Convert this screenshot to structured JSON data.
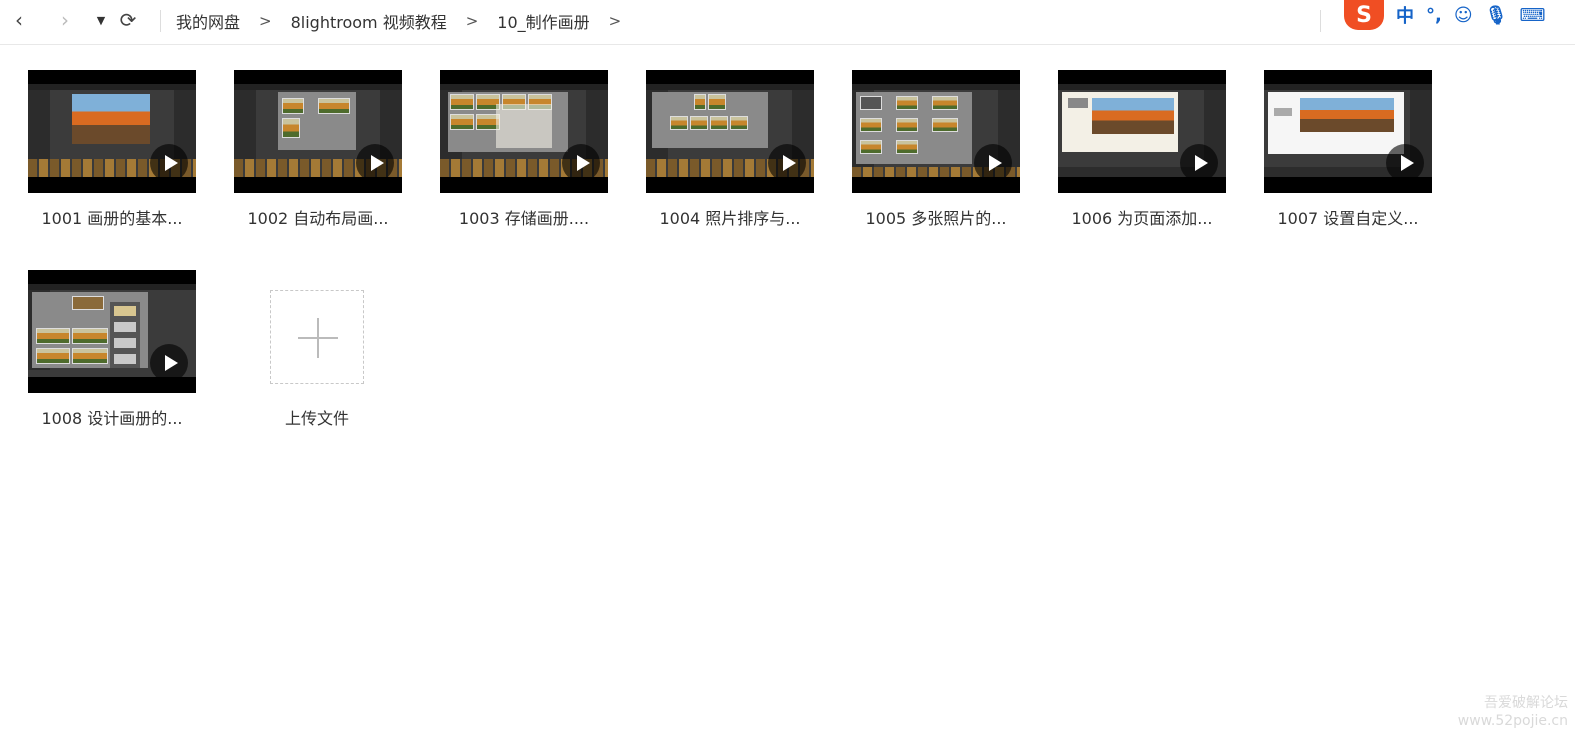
{
  "nav": {
    "back_icon": "chevron-left-icon",
    "forward_icon": "chevron-right-icon",
    "dropdown_icon": "caret-down-icon",
    "refresh_icon": "refresh-icon"
  },
  "breadcrumb": {
    "items": [
      "我的网盘",
      "8lightroom 视频教程",
      "10_制作画册"
    ],
    "separator": ">"
  },
  "ime": {
    "logo": "S",
    "mode": "中",
    "punct": "°,",
    "icons": [
      "emoji-icon",
      "microphone-icon",
      "keyboard-icon"
    ],
    "colors": {
      "logo": "#f04e23",
      "icons": "#1664c8"
    }
  },
  "files": [
    {
      "label": "1001 画册的基本..."
    },
    {
      "label": "1002 自动布局画..."
    },
    {
      "label": "1003 存储画册...."
    },
    {
      "label": "1004 照片排序与..."
    },
    {
      "label": "1005 多张照片的..."
    },
    {
      "label": "1006 为页面添加..."
    },
    {
      "label": "1007 设置自定义..."
    },
    {
      "label": "1008 设计画册的..."
    }
  ],
  "upload": {
    "label": "上传文件"
  },
  "watermark": {
    "line1": "吾爱破解论坛",
    "line2": "www.52pojie.cn"
  }
}
